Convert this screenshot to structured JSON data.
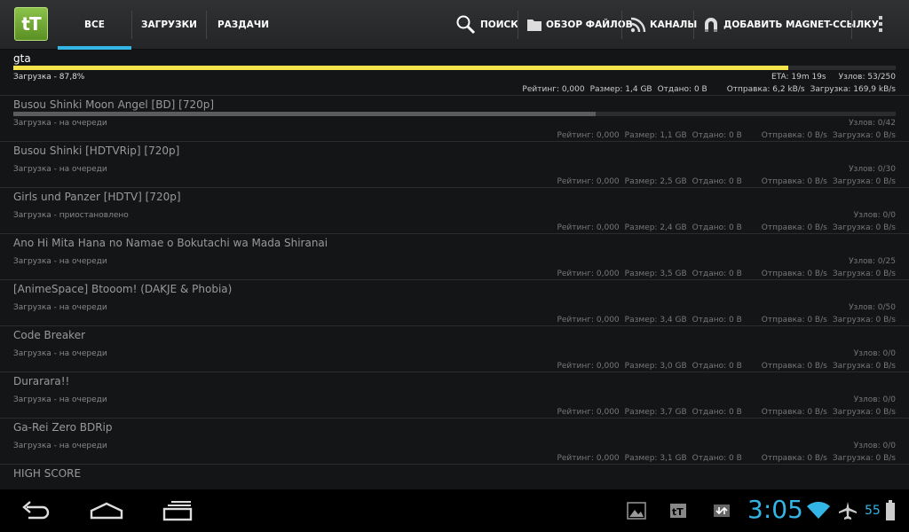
{
  "app": {
    "logo_text": "tT",
    "tabs": [
      {
        "label": "ВСЕ",
        "active": true
      },
      {
        "label": "ЗАГРУЗКИ",
        "active": false
      },
      {
        "label": "РАЗДАЧИ",
        "active": false
      }
    ],
    "actions": [
      {
        "label": "ПОИСК",
        "icon": "search-icon"
      },
      {
        "label": "ОБЗОР ФАЙЛОВ",
        "icon": "folder-icon"
      },
      {
        "label": "КАНАЛЫ",
        "icon": "rss-icon"
      },
      {
        "label": "ДОБАВИТЬ MAGNET-ССЫЛКУ",
        "icon": "magnet-icon"
      }
    ]
  },
  "torrents": [
    {
      "name": "gta",
      "progress": 0.878,
      "status": "Загрузка - 87,8%",
      "eta": "ETA: 19m 19s",
      "peers": "Узлов: 53/250",
      "rating": "Рейтинг: 0,000",
      "size": "Размер: 1,4 GB",
      "uploaded": "Отдано: 0 B",
      "up_speed": "Отправка: 6,2 kB/s",
      "down_speed": "Загрузка: 169,9 kB/s",
      "active": true
    },
    {
      "name": "Busou Shinki Moon Angel [BD] [720p]",
      "progress": 0.66,
      "status": "Загрузка - на очереди",
      "eta": "",
      "peers": "Узлов: 0/42",
      "rating": "Рейтинг: 0,000",
      "size": "Размер: 1,1 GB",
      "uploaded": "Отдано: 0 B",
      "up_speed": "Отправка: 0 B/s",
      "down_speed": "Загрузка: 0 B/s",
      "active": false
    },
    {
      "name": "Busou Shinki [HDTVRip] [720p]",
      "progress": 0,
      "status": "Загрузка - на очереди",
      "eta": "",
      "peers": "Узлов: 0/30",
      "rating": "Рейтинг: 0,000",
      "size": "Размер: 2,5 GB",
      "uploaded": "Отдано: 0 B",
      "up_speed": "Отправка: 0 B/s",
      "down_speed": "Загрузка: 0 B/s",
      "active": false
    },
    {
      "name": "Girls und Panzer [HDTV] [720p]",
      "progress": 0,
      "status": "Загрузка - приостановлено",
      "eta": "",
      "peers": "Узлов: 0/0",
      "rating": "Рейтинг: 0,000",
      "size": "Размер: 2,4 GB",
      "uploaded": "Отдано: 0 B",
      "up_speed": "Отправка: 0 B/s",
      "down_speed": "Загрузка: 0 B/s",
      "active": false
    },
    {
      "name": "Ano Hi Mita Hana no Namae o Bokutachi wa Mada Shiranai",
      "progress": 0,
      "status": "Загрузка - на очереди",
      "eta": "",
      "peers": "Узлов: 0/25",
      "rating": "Рейтинг: 0,000",
      "size": "Размер: 3,5 GB",
      "uploaded": "Отдано: 0 B",
      "up_speed": "Отправка: 0 B/s",
      "down_speed": "Загрузка: 0 B/s",
      "active": false
    },
    {
      "name": "[AnimeSpace] Btooom! (DAKJE & Phobia)",
      "progress": 0,
      "status": "Загрузка - на очереди",
      "eta": "",
      "peers": "Узлов: 0/50",
      "rating": "Рейтинг: 0,000",
      "size": "Размер: 3,4 GB",
      "uploaded": "Отдано: 0 B",
      "up_speed": "Отправка: 0 B/s",
      "down_speed": "Загрузка: 0 B/s",
      "active": false
    },
    {
      "name": "Code Breaker",
      "progress": 0,
      "status": "Загрузка - на очереди",
      "eta": "",
      "peers": "Узлов: 0/0",
      "rating": "Рейтинг: 0,000",
      "size": "Размер: 3,0 GB",
      "uploaded": "Отдано: 0 B",
      "up_speed": "Отправка: 0 B/s",
      "down_speed": "Загрузка: 0 B/s",
      "active": false
    },
    {
      "name": "Durarara!!",
      "progress": 0,
      "status": "Загрузка - на очереди",
      "eta": "",
      "peers": "Узлов: 0/0",
      "rating": "Рейтинг: 0,000",
      "size": "Размер: 3,7 GB",
      "uploaded": "Отдано: 0 B",
      "up_speed": "Отправка: 0 B/s",
      "down_speed": "Загрузка: 0 B/s",
      "active": false
    },
    {
      "name": "Ga-Rei Zero BDRip",
      "progress": 0,
      "status": "Загрузка - на очереди",
      "eta": "",
      "peers": "Узлов: 0/0",
      "rating": "Рейтинг: 0,000",
      "size": "Размер: 3,1 GB",
      "uploaded": "Отдано: 0 B",
      "up_speed": "Отправка: 0 B/s",
      "down_speed": "Загрузка: 0 B/s",
      "active": false
    },
    {
      "name": "HIGH SCORE",
      "progress": 0,
      "status": "",
      "eta": "",
      "peers": "",
      "rating": "",
      "size": "",
      "uploaded": "",
      "up_speed": "",
      "down_speed": "",
      "active": false
    }
  ],
  "system": {
    "clock": "3:05",
    "battery": "55",
    "accent": "#33b5e5",
    "progress_color": "#f4e34a"
  }
}
